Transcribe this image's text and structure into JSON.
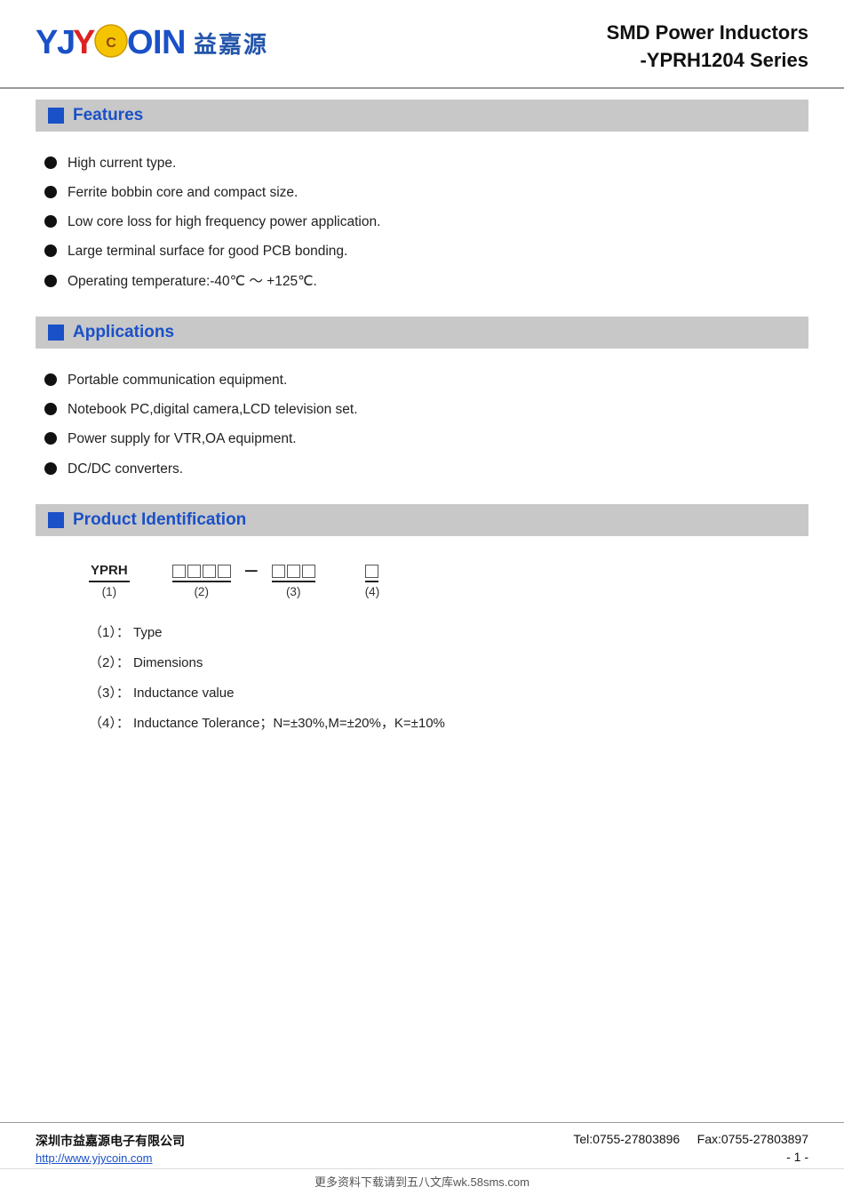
{
  "header": {
    "title_line1": "SMD Power Inductors",
    "title_line2": "-YPRH1204 Series",
    "logo_cn": "益嘉源"
  },
  "features": {
    "section_title": "Features",
    "items": [
      "High current type.",
      "Ferrite bobbin core and compact size.",
      "Low core loss for high frequency power application.",
      "Large terminal surface for good PCB bonding.",
      "Operating temperature:-40℃ ～ +125℃."
    ]
  },
  "applications": {
    "section_title": "Applications",
    "items": [
      "Portable communication equipment.",
      "Notebook PC,digital camera,LCD television set.",
      "Power supply for VTR,OA equipment.",
      "DC/DC converters."
    ]
  },
  "product_identification": {
    "section_title": "Product Identification",
    "diagram_label": "YPRH",
    "part1_label": "(1)",
    "part2_label": "(2)",
    "part3_label": "(3)",
    "part4_label": "(4)",
    "description_1": "（1）：  Type",
    "description_2": "（2）：  Dimensions",
    "description_3": "（3）：  Inductance value",
    "description_4": "（4）：  Inductance Tolerance；N=±30%,M=±20%，K=±10%"
  },
  "footer": {
    "company": "深圳市益嘉源电子有限公司",
    "url": "http://www.yjycoin.com",
    "tel": "Tel:0755-27803896",
    "fax": "Fax:0755-27803897",
    "page": "- 1 -"
  },
  "watermark": "更多资料下载请到五八文库wk.58sms.com"
}
